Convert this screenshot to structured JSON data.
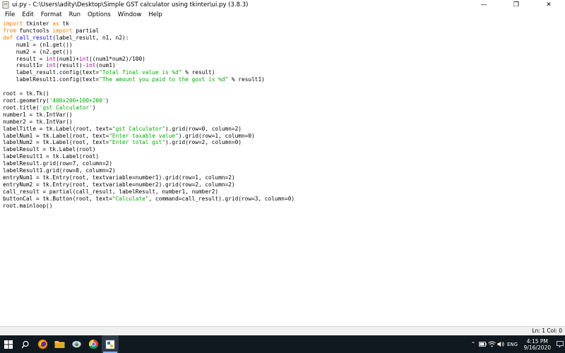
{
  "window": {
    "title": "ui.py - C:\\Users\\adity\\Desktop\\Simple GST calculator using tkinter\\ui.py (3.8.3)",
    "minimize": "—",
    "maximize": "❐",
    "close": "✕"
  },
  "menu": [
    "File",
    "Edit",
    "Format",
    "Run",
    "Options",
    "Window",
    "Help"
  ],
  "status": {
    "text": "Ln: 1   Col: 0"
  },
  "taskbar": {
    "time": "4:15 PM",
    "date": "9/16/2020",
    "language": "ENG",
    "apps": [
      "search-icon",
      "firefox-icon",
      "file-explorer-icon",
      "app-icon",
      "chrome-icon",
      "idle-python-icon"
    ]
  }
}
